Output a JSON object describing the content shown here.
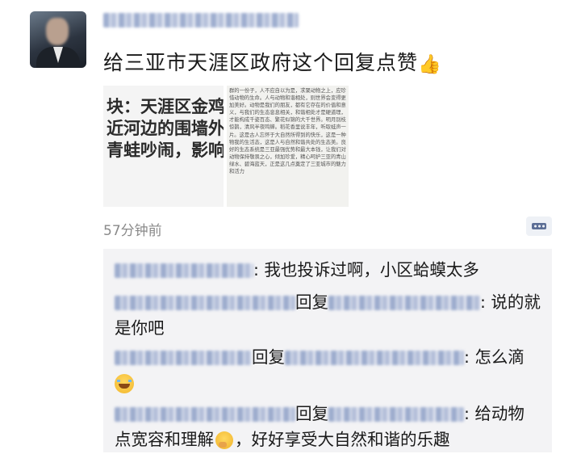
{
  "post": {
    "text": "给三亚市天涯区政府这个回复点赞",
    "thumb_emoji": "👍",
    "time": "57分钟前"
  },
  "images": {
    "left_lines": [
      "块：天涯区金鸡岭",
      "近河边的围墙外面",
      "青蛙吵闹，影响居"
    ],
    "right_text": "群的一份子，人不应自以为是，求聚动物之上，应珍惜动物的生命。人与动物和谐相处，则世界会变得更加美好。动物是我们的朋友，都有它存在的价值和意义，与我们的生态息息相关，和谐相处才是硬道理，才能构成千姿百态、繁花似锦的大千世界。明月别枝惊鹊，清风半夜鸣蝉。稻花香里说丰年，听取蛙声一片。这是古人忘怀于大自然所得到的快乐，这是一种物我的生活态，这是人与自然和谐共处的生态美。良好的生态系统是三亚最强优势和最大本钱，让我们对动物保持敬畏之心，倾加珍爱，精心呵护三亚的青山绿水、碧海蓝天，正是这几点奠定了三亚城市的魅力和活力"
  },
  "comments": [
    {
      "text": ": 我也投诉过啊，小区蛤蟆太多",
      "line2": ""
    },
    {
      "reply": "回复",
      "text": ": 说的就",
      "line2": "是你吧"
    },
    {
      "reply": "回复",
      "text": ": 怎么滴",
      "line2": ""
    },
    {
      "reply": "回复",
      "text": ": 给动物",
      "line2": "点宽容和理解",
      "line2_tail": "，好好享受大自然和谐的乐趣"
    }
  ],
  "icons": {
    "comment_button": "comment-icon",
    "laugh": "laughing-tears-emoji",
    "think": "thinking-emoji"
  },
  "colors": {
    "name_link": "#5d6f96",
    "time": "#8a8a8a",
    "comment_bg": "#f3f3f5"
  }
}
